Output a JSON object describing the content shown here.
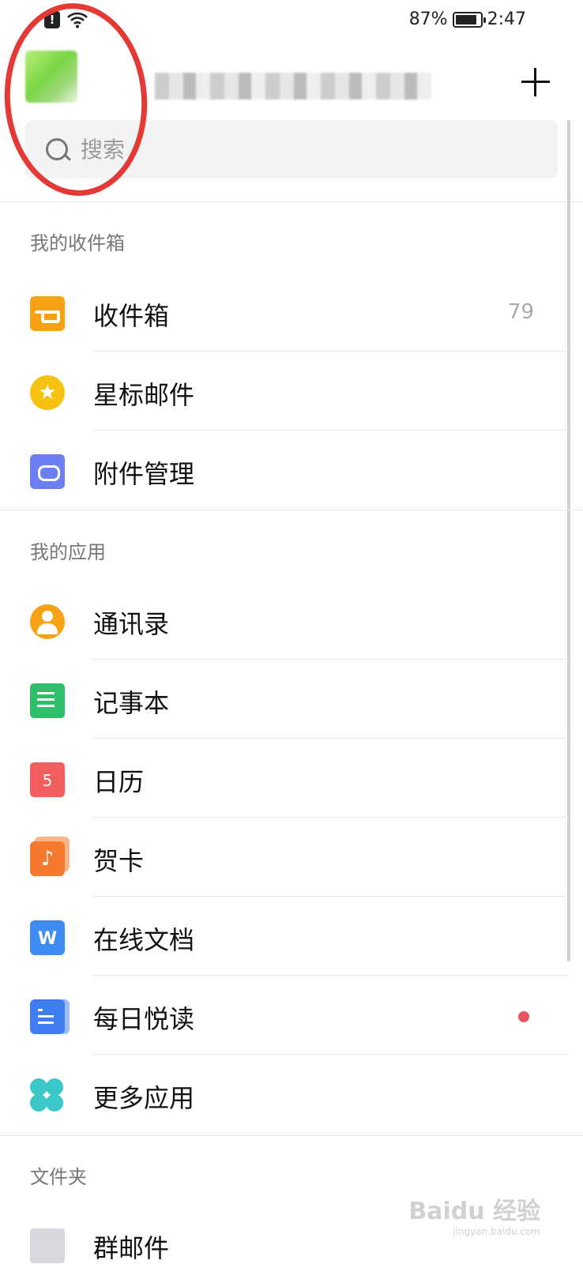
{
  "status_bar": {
    "battery": "87%",
    "battery_level": 0.87,
    "time": "2:47"
  },
  "header": {
    "add_label": "+"
  },
  "search": {
    "placeholder": "搜索"
  },
  "sections": {
    "inbox": {
      "title": "我的收件箱",
      "items": [
        {
          "label": "收件箱",
          "count": "79",
          "icon": "inbox-tray-icon",
          "color": "#f6a214"
        },
        {
          "label": "星标邮件",
          "icon": "star-icon",
          "color": "#f7c20f"
        },
        {
          "label": "附件管理",
          "icon": "attachment-icon",
          "color": "#6b7ff0"
        }
      ]
    },
    "apps": {
      "title": "我的应用",
      "items": [
        {
          "label": "通讯录",
          "icon": "contacts-icon",
          "color": "#f6a214"
        },
        {
          "label": "记事本",
          "icon": "notepad-icon",
          "color": "#2fbe6b"
        },
        {
          "label": "日历",
          "icon": "calendar-icon",
          "icon_text": "5",
          "color": "#f25d5d"
        },
        {
          "label": "贺卡",
          "icon": "greeting-card-icon",
          "icon_text": "♪",
          "color": "#f57a2e"
        },
        {
          "label": "在线文档",
          "icon": "online-doc-icon",
          "icon_text": "W",
          "color": "#3d8cf2"
        },
        {
          "label": "每日悦读",
          "icon": "daily-reading-icon",
          "color": "#3f7ef0",
          "badge": "unread-dot"
        },
        {
          "label": "更多应用",
          "icon": "more-apps-icon",
          "color": "#3cc8c8"
        }
      ]
    },
    "folders": {
      "title": "文件夹",
      "items": [
        {
          "label": "群邮件",
          "icon": "folder-icon",
          "color": "#d8d8de"
        }
      ]
    }
  },
  "watermark": {
    "text": "Baidu 经验",
    "sub": "jingyan.baidu.com"
  }
}
